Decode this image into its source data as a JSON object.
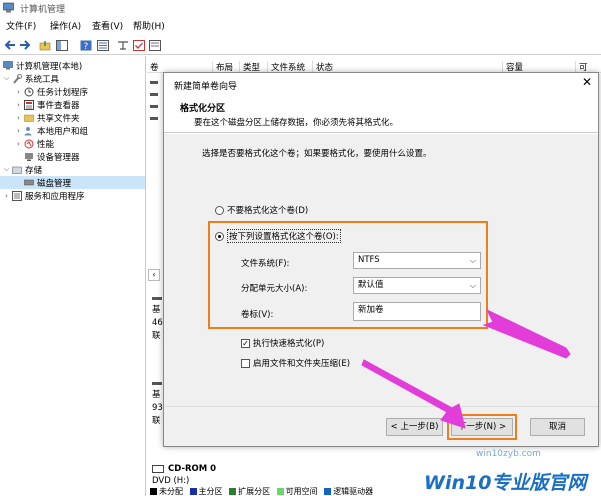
{
  "window": {
    "title": "计算机管理"
  },
  "menu": [
    {
      "label": "文件(F)"
    },
    {
      "label": "操作(A)"
    },
    {
      "label": "查看(V)"
    },
    {
      "label": "帮助(H)"
    }
  ],
  "tree": {
    "root": "计算机管理(本地)",
    "system_tools": "系统工具",
    "task_scheduler": "任务计划程序",
    "event_viewer": "事件查看器",
    "shared_folders": "共享文件夹",
    "local_users": "本地用户和组",
    "performance": "性能",
    "device_manager": "设备管理器",
    "storage": "存储",
    "disk_management": "磁盘管理",
    "services_apps": "服务和应用程序"
  },
  "columns": [
    "卷",
    "布局",
    "类型",
    "文件系统",
    "状态",
    "容量",
    "可"
  ],
  "dialog": {
    "title": "新建简单卷向导",
    "header_title": "格式化分区",
    "header_sub": "要在这个磁盘分区上储存数据，你必须先将其格式化。",
    "prompt": "选择是否要格式化这个卷；如果要格式化，要使用什么设置。",
    "opt_no_format": "不要格式化这个卷(D)",
    "opt_format": "按下列设置格式化这个卷(O):",
    "fs_label": "文件系统(F):",
    "fs_value": "NTFS",
    "alloc_label": "分配单元大小(A):",
    "alloc_value": "默认值",
    "vol_label": "卷标(V):",
    "vol_value": "新加卷",
    "quick_format": "执行快速格式化(P)",
    "compression": "启用文件和文件夹压缩(E)",
    "btn_back": "< 上一步(B)",
    "btn_next": "下一步(N) >",
    "btn_cancel": "取消"
  },
  "disks": {
    "d1_lines": [
      "基",
      "46",
      "联"
    ],
    "d2_lines": [
      "基",
      "93",
      "联"
    ],
    "cdrom_name": "CD-ROM 0",
    "cdrom_type": "DVD (H:)"
  },
  "legend": [
    "未分配",
    "主分区",
    "扩展分区",
    "可用空间",
    "逻辑驱动器"
  ],
  "legend_colors": [
    "#000000",
    "#1a2ea8",
    "#2e7d32",
    "#6bd66b",
    "#1565c0"
  ],
  "watermark": {
    "brand": "Win10专业版官网",
    "site": "win10zyb.com"
  },
  "colors": {
    "highlight": "#f07d1c",
    "arrow": "#e23cd9"
  }
}
